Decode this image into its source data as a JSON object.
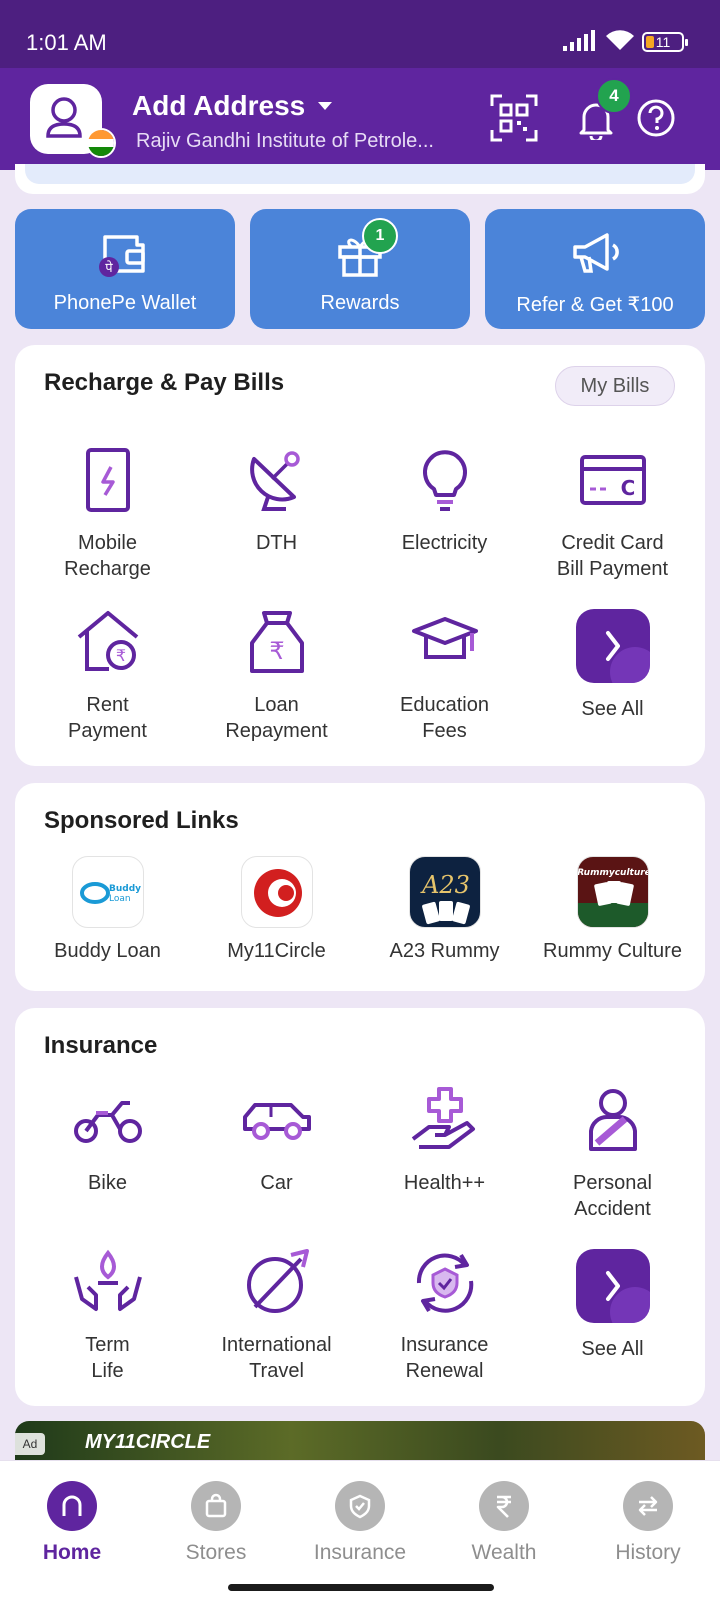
{
  "status": {
    "time": "1:01 AM",
    "battery": "11"
  },
  "header": {
    "title": "Add Address",
    "subtitle": "Rajiv Gandhi Institute of Petrole...",
    "notification_count": "4"
  },
  "quick_actions": [
    {
      "label": "PhonePe Wallet",
      "icon": "wallet-icon"
    },
    {
      "label": "Rewards",
      "icon": "gift-icon",
      "badge": "1"
    },
    {
      "label": "Refer & Get ₹100",
      "icon": "megaphone-icon"
    }
  ],
  "recharge": {
    "title": "Recharge & Pay Bills",
    "my_bills": "My Bills",
    "items": [
      {
        "line1": "Mobile",
        "line2": "Recharge",
        "icon": "mobile-recharge-icon"
      },
      {
        "line1": "DTH",
        "line2": "",
        "icon": "satellite-dish-icon"
      },
      {
        "line1": "Electricity",
        "line2": "",
        "icon": "bulb-icon"
      },
      {
        "line1": "Credit Card",
        "line2": "Bill Payment",
        "icon": "credit-card-icon"
      },
      {
        "line1": "Rent",
        "line2": "Payment",
        "icon": "house-rupee-icon"
      },
      {
        "line1": "Loan",
        "line2": "Repayment",
        "icon": "money-bag-icon"
      },
      {
        "line1": "Education",
        "line2": "Fees",
        "icon": "graduation-cap-icon"
      },
      {
        "line1": "See All",
        "line2": "",
        "icon": "chevron-right-icon"
      }
    ]
  },
  "sponsored": {
    "title": "Sponsored Links",
    "items": [
      {
        "label": "Buddy Loan",
        "logo_text": "Buddy Loan"
      },
      {
        "label": "My11Circle",
        "logo_text": ""
      },
      {
        "label": "A23 Rummy",
        "logo_text": "A23"
      },
      {
        "label": "Rummy Culture",
        "logo_text": "Rummyculture"
      }
    ]
  },
  "insurance": {
    "title": "Insurance",
    "items": [
      {
        "line1": "Bike",
        "line2": "",
        "icon": "motorbike-icon"
      },
      {
        "line1": "Car",
        "line2": "",
        "icon": "car-icon"
      },
      {
        "line1": "Health++",
        "line2": "",
        "icon": "health-hand-icon"
      },
      {
        "line1": "Personal",
        "line2": "Accident",
        "icon": "person-bandage-icon"
      },
      {
        "line1": "Term",
        "line2": "Life",
        "icon": "life-hands-icon"
      },
      {
        "line1": "International",
        "line2": "Travel",
        "icon": "plane-globe-icon"
      },
      {
        "line1": "Insurance",
        "line2": "Renewal",
        "icon": "renewal-shield-icon"
      },
      {
        "line1": "See All",
        "line2": "",
        "icon": "chevron-right-icon"
      }
    ]
  },
  "banner": {
    "ad_label": "Ad",
    "brand": "MY11CIRCLE"
  },
  "bottom_nav": [
    {
      "label": "Home",
      "icon": "home-icon",
      "active": true
    },
    {
      "label": "Stores",
      "icon": "bag-icon"
    },
    {
      "label": "Insurance",
      "icon": "shield-icon"
    },
    {
      "label": "Wealth",
      "icon": "rupee-icon"
    },
    {
      "label": "History",
      "icon": "swap-arrows-icon"
    }
  ],
  "colors": {
    "brand": "#5f259f",
    "tile": "#4b84d9",
    "badge": "#22a34f",
    "icon": "#5f259f"
  }
}
